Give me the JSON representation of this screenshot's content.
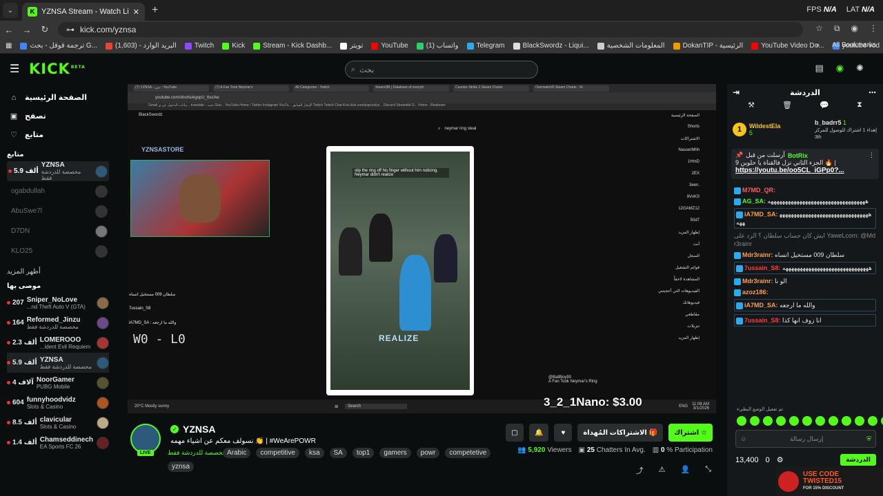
{
  "browser": {
    "tab_title": "YZNSA Stream - Watch Live on",
    "fps_label": "FPS",
    "fps_value": "N/A",
    "lat_label": "LAT",
    "lat_value": "N/A",
    "url": "kick.com/yznsa",
    "bookmarks": [
      {
        "label": "ترجمة قوقل - بحث G...",
        "color": "#4285f4"
      },
      {
        "label": "البريد الوارد - (1,603)",
        "color": "#ea4335"
      },
      {
        "label": "Twitch",
        "color": "#9146ff"
      },
      {
        "label": "Kick",
        "color": "#53fc18"
      },
      {
        "label": "Stream - Kick Dashb...",
        "color": "#53fc18"
      },
      {
        "label": "تويتر",
        "color": "#ffffff"
      },
      {
        "label": "YouTube",
        "color": "#ff0000"
      },
      {
        "label": "واتساب (1)",
        "color": "#25d366"
      },
      {
        "label": "Telegram",
        "color": "#2aabee"
      },
      {
        "label": "BlackSwordz - Liqui...",
        "color": "#dddddd"
      },
      {
        "label": "المعلومات الشخصية",
        "color": "#cccccc"
      },
      {
        "label": "DokanTIP - الرئيسية",
        "color": "#f29900"
      },
      {
        "label": "YouTube Video Do...",
        "color": "#ff0000"
      },
      {
        "label": "youtube vod",
        "color": "#4285f4"
      }
    ],
    "all_bookmarks": "All Bookmarks"
  },
  "kick": {
    "logo": "KICK",
    "logo_beta": "BETA",
    "search_placeholder": "بحث"
  },
  "sidebar": {
    "nav": [
      {
        "label": "الصفحة الرئيسية",
        "icon": "home-icon",
        "glyph": "⌂"
      },
      {
        "label": "تصفح",
        "icon": "browse-icon",
        "glyph": "▣"
      },
      {
        "label": "متابع",
        "icon": "heart-icon",
        "glyph": "♡"
      }
    ],
    "following_heading": "متابع",
    "following": [
      {
        "name": "YZNSA",
        "sub": "مخصصة للدردشة فقط",
        "count": "5.9 ألف",
        "live": true,
        "active": true,
        "avatar": "#2c5a7a"
      },
      {
        "name": "ogabdullah",
        "sub": "",
        "count": "",
        "live": false,
        "active": false,
        "avatar": "#333"
      },
      {
        "name": "AbuSwe7l",
        "sub": "",
        "count": "",
        "live": false,
        "active": false,
        "avatar": "#333"
      },
      {
        "name": "D7DN",
        "sub": "",
        "count": "",
        "live": false,
        "active": false,
        "avatar": "#777"
      },
      {
        "name": "KLO25",
        "sub": "",
        "count": "",
        "live": false,
        "active": false,
        "avatar": "#333"
      }
    ],
    "show_more": "أظهر المزيد",
    "recommended_heading": "موصى بها",
    "recommended": [
      {
        "name": "Sniper_NoLove",
        "sub": "...nd Theft Auto V (GTA)",
        "count": "207",
        "active": false,
        "avatar": "#8a6a4a"
      },
      {
        "name": "Reformed_Jinzu",
        "sub": "مخصصة للدردشة فقط",
        "count": "164",
        "active": false,
        "avatar": "#6a4a8a"
      },
      {
        "name": "LOMEROOO",
        "sub": "...ident Evil Requiem",
        "count": "2.3 ألف",
        "active": false,
        "avatar": "#a33"
      },
      {
        "name": "YZNSA",
        "sub": "مخصصة للدردشة فقط",
        "count": "5.9 ألف",
        "active": true,
        "avatar": "#2c5a7a"
      },
      {
        "name": "NoorGamer",
        "sub": "PUBG Mobile",
        "count": "4 آلاف",
        "active": false,
        "avatar": "#553"
      },
      {
        "name": "funnyhoodvidz",
        "sub": "Slots & Casino",
        "count": "604",
        "active": false,
        "avatar": "#a52"
      },
      {
        "name": "clavicular",
        "sub": "Slots & Casino",
        "count": "8.5 ألف",
        "active": false,
        "avatar": "#ba8"
      },
      {
        "name": "Chamseddinech",
        "sub": "EA Sports FC 26",
        "count": "1.4 ألف",
        "active": false,
        "avatar": "#622"
      }
    ]
  },
  "video": {
    "inner_tabs": [
      "(7) YZNSA - يزن - YouTube",
      "(7) A Fan Took Neymar's",
      "All Categories - Twitch",
      "SteamDB | Database of everyth",
      "Counter-Strike 2 Steam Charts",
      "Overwatch® Steam Charts - St"
    ],
    "inner_url": "youtube.com/shorts/egopU_6scAw",
    "inner_bookmarks": "Gmail   بيانات الدخول عن ي...   translate - بحث Goo...   YouTube   Home / Twitter   Instagram   YouTu...   الإيجار السابق   Twitch   Twitch Chat   Kick   kick.com/popout/yz...   Discord Streamkit O...   Home - Restream",
    "yt_search": "neymar ring steal",
    "short_caption": "slip the ring off his finger without him noticing. Neymar didn't realize",
    "realize_text": "REALIZE",
    "short_title": "A Fan Took Neymar's Ring",
    "short_channel": "@BallBoy90",
    "store_text": "YZNSASTORE",
    "brand_text": "BlackSwordz",
    "yt_sidebar": [
      "الصفحة الرئيسية",
      "Shorts",
      "الاشتراكات",
      "NasserMhh",
      "1HmD",
      "2EX",
      "3een.",
      "9VvKS",
      "12GAMZ12",
      "50d7",
      "إظهار المزيد",
      "أنت",
      "السجل",
      "قوائم التشغيل",
      "المشاهدة لاحقاً",
      "الفيديوهات التي أعجبتني",
      "فيديوهاتك",
      "مقاطعي",
      "تنزيلات",
      "إظهار المزيد"
    ],
    "overlay_chat": [
      "سلطان 009 مستخيل انساه",
      "7ussain_S8",
      "iA7MD_SA : والله ما ارجعه"
    ],
    "score": "W0 - L0",
    "weather": "20°C Mostly sunny",
    "taskbar_search": "Search",
    "clock": "11:08 AM",
    "date": "3/1/2026",
    "lang": "ENG",
    "donation": "3_2_1Nano: $3.00"
  },
  "stream": {
    "name": "YZNSA",
    "title": "نسولف معكم عن اشياء مهمه 👏 | #WeArePOWR",
    "category": "مخصصة للدردشة فقط",
    "live": "LIVE",
    "tags": [
      "Arabic",
      "competitive",
      "ksa",
      "SA",
      "top1",
      "gamers",
      "powr",
      "competetive"
    ],
    "tag_extra": "yznsa",
    "follow_btn": "اشتراك",
    "gift_btn": "الاشتراكات المُهداة",
    "viewers": "5,920",
    "viewers_label": "Viewers",
    "chatters": "25",
    "chatters_label": "Chatters In Avg.",
    "participation": "0",
    "participation_label": "% Participation"
  },
  "chat": {
    "title": "الدردشة",
    "leader1_name": "WildestEla",
    "leader1_count": "5",
    "leader2_name": "b_badrr5",
    "leader2_count": "1",
    "leader2_sub": "إهداء 1 اشتراك للوصول للمركز 3th",
    "pinned_by": "أرسلت من قبل",
    "pinned_user": "BotRix",
    "pinned_text": "الجزء الثاني نزل فالقناة يا حلوين 9 🔥 |",
    "pinned_link": "https://youtu.be/oo5CL_iGPp0?...",
    "messages": [
      {
        "user": "M7MD_QR:",
        "text": "",
        "color": "#ff5e5e"
      },
      {
        "user": "AG_SA:",
        "text": "ههههههههههههههههههههههههههههههههههه",
        "color": "#53fc18"
      },
      {
        "user": "iA7MD_SA:",
        "text": "ههههههههههههههههههههههههههههههههههه",
        "color": "#ff9f43"
      },
      {
        "user": "",
        "text": "ايش كان حساب سلطان ؟ الرد على YaweLcom: @Mdr3rainr",
        "color": "#888"
      },
      {
        "user": "Mdr3rainr:",
        "text": "سلطان 009 مستخيل انساه",
        "color": "#ff9f43"
      },
      {
        "user": "7ussain_S8:",
        "text": "ههههههههههههههههههههههههههههههه",
        "color": "#ff3b3b"
      },
      {
        "user": "Mdr3rainr:",
        "text": "الو نا",
        "color": "#ff9f43"
      },
      {
        "user": "azoz186:",
        "text": "",
        "color": "#ff9f43"
      },
      {
        "user": "iA7MD_SA:",
        "text": "والله ما ارجعه",
        "color": "#ff9f43"
      },
      {
        "user": "7ussain_S8:",
        "text": "انا زوف انها كذا",
        "color": "#ff3b3b"
      }
    ],
    "system_note": "تم تفعيل الوضع البطيء",
    "input_placeholder": "إرسال رسالة",
    "points": "13,400",
    "zero": "0",
    "chat_btn": "الدردشة",
    "ad_line1": "USE CODE",
    "ad_line2": "TWISTED15",
    "ad_line3": "FOR 15% DISCOUNT"
  }
}
